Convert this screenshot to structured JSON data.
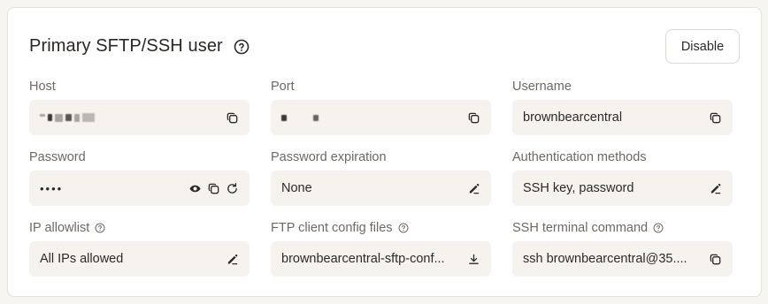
{
  "header": {
    "title": "Primary SFTP/SSH user",
    "disable_label": "Disable"
  },
  "fields": {
    "host": {
      "label": "Host"
    },
    "port": {
      "label": "Port"
    },
    "username": {
      "label": "Username",
      "value": "brownbearcentral"
    },
    "password": {
      "label": "Password",
      "value": "••••"
    },
    "password_expiration": {
      "label": "Password expiration",
      "value": "None"
    },
    "auth_methods": {
      "label": "Authentication methods",
      "value": "SSH key, password"
    },
    "ip_allowlist": {
      "label": "IP allowlist",
      "value": "All IPs allowed"
    },
    "ftp_config": {
      "label": "FTP client config files",
      "value": "brownbearcentral-sftp-conf..."
    },
    "ssh_command": {
      "label": "SSH terminal command",
      "value": "ssh brownbearcentral@35...."
    }
  },
  "icons": {
    "copy": "copy-icon",
    "edit": "pencil-icon",
    "eye": "eye-icon",
    "refresh": "refresh-icon",
    "download": "download-icon",
    "help": "help-circle-icon"
  },
  "colors": {
    "card_bg": "#ffffff",
    "field_bg": "#f6f3ef",
    "label": "#6f6861",
    "text": "#2c2a28",
    "border": "#e4e1dc"
  }
}
